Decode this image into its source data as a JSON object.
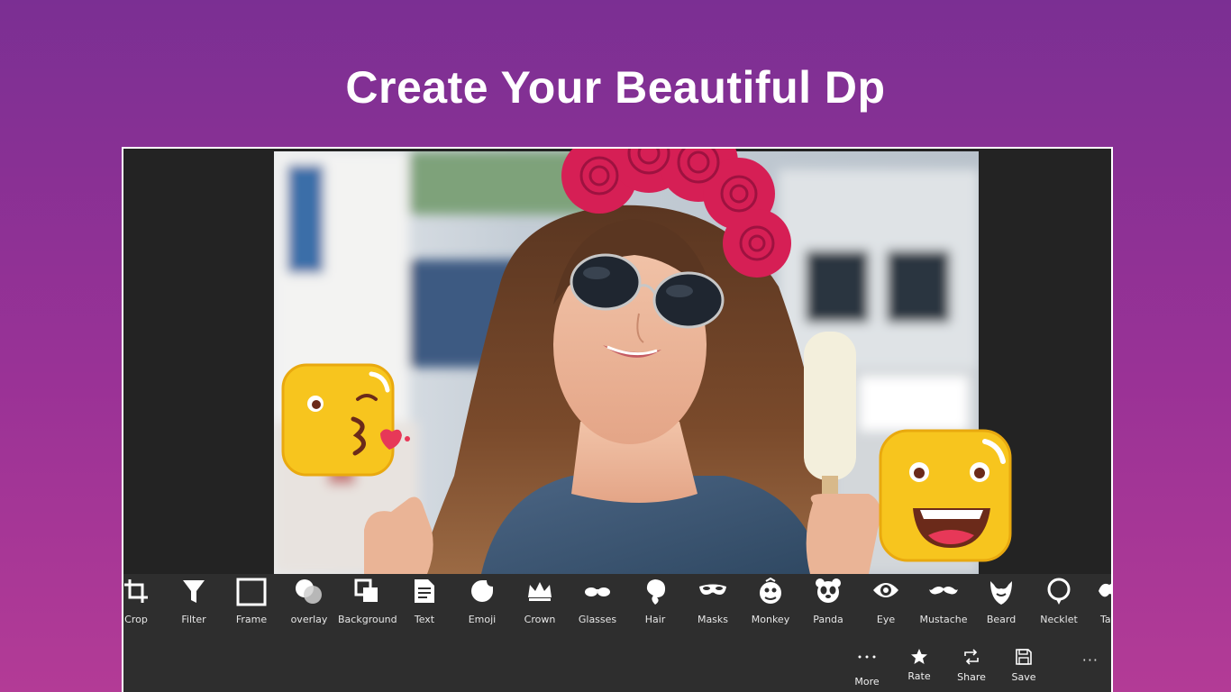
{
  "headline": "Create Your Beautiful Dp",
  "colors": {
    "background_top": "#7b2f93",
    "background_bottom": "#b33b96",
    "app_dark": "#232323",
    "toolbar": "#2e2e2e",
    "emoji_yellow": "#f7c51e",
    "crown_red": "#d61f55"
  },
  "tools": [
    {
      "label": "Crop",
      "icon": "crop-icon"
    },
    {
      "label": "Filter",
      "icon": "filter-icon"
    },
    {
      "label": "Frame",
      "icon": "frame-icon"
    },
    {
      "label": "overlay",
      "icon": "overlay-icon"
    },
    {
      "label": "Background",
      "icon": "background-icon"
    },
    {
      "label": "Text",
      "icon": "text-icon"
    },
    {
      "label": "Emoji",
      "icon": "emoji-icon"
    },
    {
      "label": "Crown",
      "icon": "crown-icon"
    },
    {
      "label": "Glasses",
      "icon": "glasses-icon"
    },
    {
      "label": "Hair",
      "icon": "hair-icon"
    },
    {
      "label": "Masks",
      "icon": "mask-icon"
    },
    {
      "label": "Monkey",
      "icon": "monkey-icon"
    },
    {
      "label": "Panda",
      "icon": "panda-icon"
    },
    {
      "label": "Eye",
      "icon": "eye-icon"
    },
    {
      "label": "Mustache",
      "icon": "mustache-icon"
    },
    {
      "label": "Beard",
      "icon": "beard-icon"
    },
    {
      "label": "Necklet",
      "icon": "necklace-icon"
    },
    {
      "label": "Tat",
      "icon": "tattoo-icon"
    }
  ],
  "appbar": [
    {
      "label": "More",
      "icon": "more-icon"
    },
    {
      "label": "Rate",
      "icon": "star-icon"
    },
    {
      "label": "Share",
      "icon": "share-icon"
    },
    {
      "label": "Save",
      "icon": "save-icon"
    }
  ],
  "overflow": "···"
}
